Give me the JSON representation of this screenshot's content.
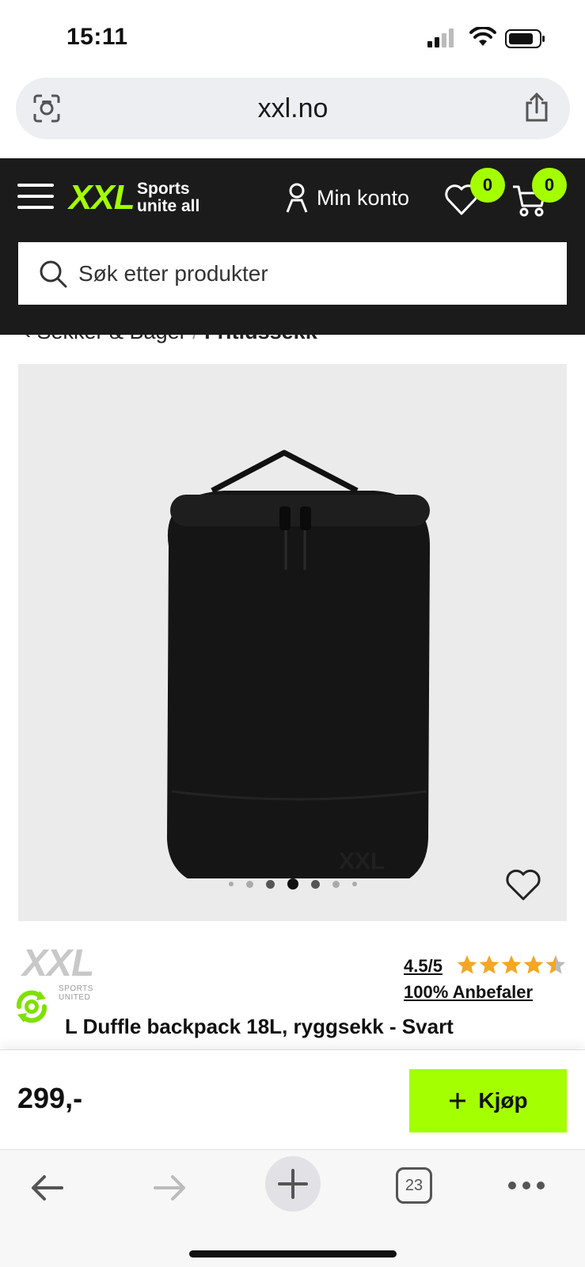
{
  "status_bar": {
    "time": "15:11"
  },
  "browser": {
    "url": "xxl.no",
    "tab_count": "23"
  },
  "header": {
    "logo_text": "XXL",
    "tagline_line1": "Sports",
    "tagline_line2": "unite all",
    "account_label": "Min konto",
    "wishlist_count": "0",
    "cart_count": "0",
    "search_placeholder": "Søk etter produkter"
  },
  "breadcrumb": {
    "parent": "Sekker & Bager",
    "separator": "/",
    "current": "Fritidssekk"
  },
  "gallery": {
    "dot_count": 7,
    "active_dot": 3
  },
  "product": {
    "brand_logo": "XXL",
    "brand_sub": "SPORTS UNITED",
    "rating": "4.5/5",
    "rating_value": 4.5,
    "rating_max": 5,
    "recommend": "100% Anbefaler",
    "title": "L Duffle backpack 18L, ryggsekk - Svart",
    "price": "299,-",
    "buy_label": "Kjøp"
  },
  "colors": {
    "accent": "#a4ff00",
    "header_bg": "#1b1b1b",
    "star": "#f5a623"
  }
}
